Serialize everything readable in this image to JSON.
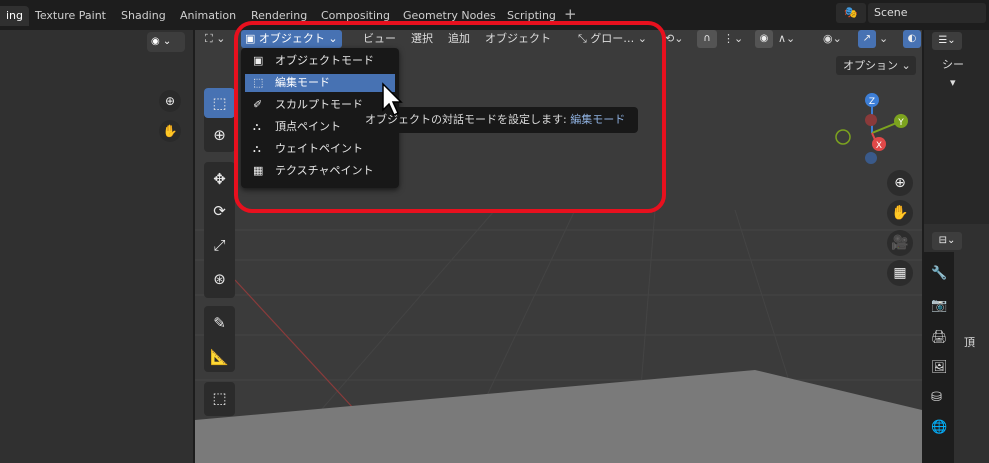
{
  "workspace_tabs": [
    "ing",
    "Texture Paint",
    "Shading",
    "Animation",
    "Rendering",
    "Compositing",
    "Geometry Nodes",
    "Scripting"
  ],
  "add_tab_label": "+",
  "scene": {
    "icon": "🎭",
    "name": "Scene"
  },
  "header": {
    "mode_label": "オブジェクト",
    "mode_chevron": "⌄",
    "view": "ビュー",
    "select": "選択",
    "add": "追加",
    "object": "オブジェクト",
    "orientation": "グロー…"
  },
  "options_label": "オプション ⌄",
  "mode_menu": {
    "items": [
      {
        "label": "オブジェクトモード",
        "icon": "▣",
        "highlighted": false
      },
      {
        "label": "編集モード",
        "icon": "⬚",
        "highlighted": true
      },
      {
        "label": "スカルプトモード",
        "icon": "✐",
        "highlighted": false
      },
      {
        "label": "頂点ペイント",
        "icon": "⛬",
        "highlighted": false
      },
      {
        "label": "ウェイトペイント",
        "icon": "⛬",
        "highlighted": false
      },
      {
        "label": "テクスチャペイント",
        "icon": "▦",
        "highlighted": false
      }
    ]
  },
  "tooltip": {
    "prefix": "オブジェクトの対話モードを設定します:",
    "mode": "編集モード"
  },
  "gizmo_axes": {
    "z": "Z",
    "y": "Y",
    "x": "X"
  },
  "outliner": {
    "item1": "シー",
    "item2": "▾"
  },
  "properties": {
    "label": "頂"
  },
  "colors": {
    "accent": "#4772b3",
    "highlight_border": "#e8101e",
    "axis_x": "#e04848",
    "axis_y": "#7ca31f",
    "axis_z": "#3d7ed6"
  }
}
